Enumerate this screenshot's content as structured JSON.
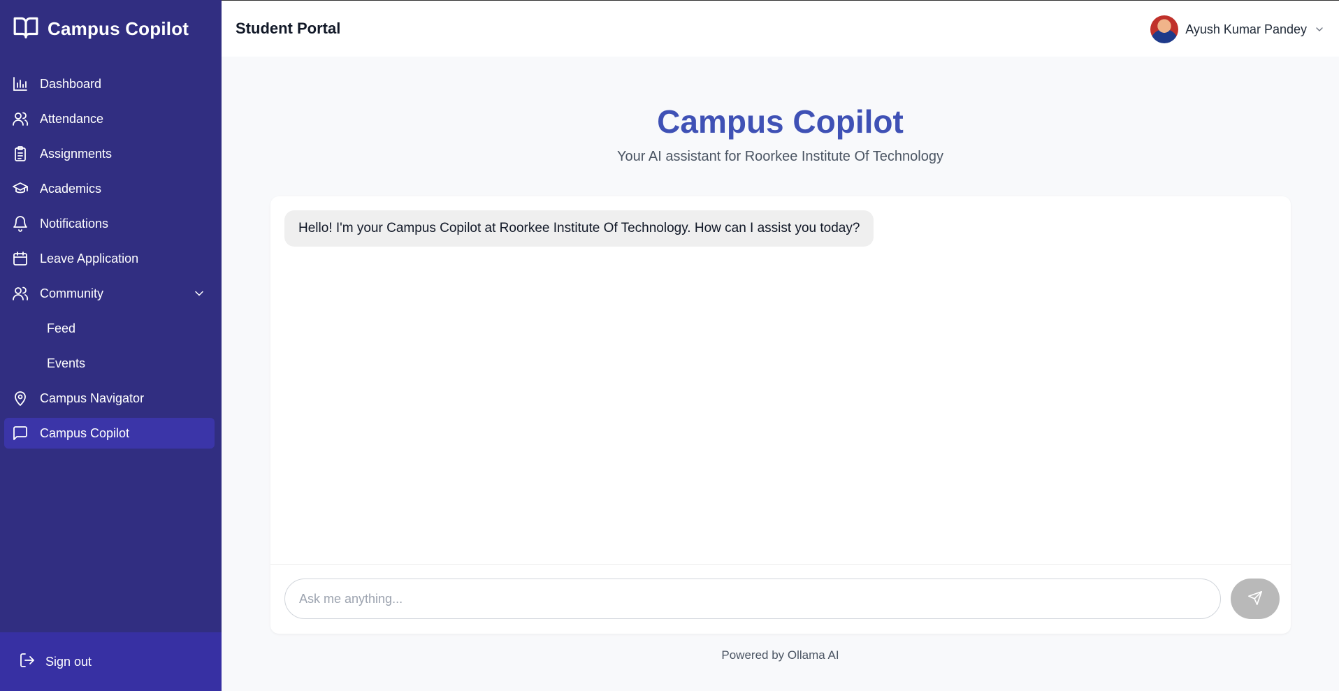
{
  "app": {
    "brand": "Campus Copilot"
  },
  "sidebar": {
    "items": [
      {
        "label": "Dashboard",
        "icon": "bar-chart-icon"
      },
      {
        "label": "Attendance",
        "icon": "users-icon"
      },
      {
        "label": "Assignments",
        "icon": "clipboard-icon"
      },
      {
        "label": "Academics",
        "icon": "graduation-cap-icon"
      },
      {
        "label": "Notifications",
        "icon": "bell-icon"
      },
      {
        "label": "Leave Application",
        "icon": "calendar-icon"
      },
      {
        "label": "Community",
        "icon": "users-icon",
        "expanded": true
      },
      {
        "label": "Campus Navigator",
        "icon": "map-pin-icon"
      },
      {
        "label": "Campus Copilot",
        "icon": "message-square-icon",
        "active": true
      }
    ],
    "community_sub": [
      {
        "label": "Feed"
      },
      {
        "label": "Events"
      }
    ],
    "signout_label": "Sign out"
  },
  "header": {
    "title": "Student Portal",
    "user_name": "Ayush Kumar Pandey"
  },
  "main": {
    "title": "Campus Copilot",
    "subtitle": "Your AI assistant for Roorkee Institute Of Technology",
    "messages": [
      {
        "role": "assistant",
        "text": "Hello! I'm your Campus Copilot at Roorkee Institute Of Technology. How can I assist you today?"
      }
    ],
    "input_placeholder": "Ask me anything...",
    "input_value": "",
    "footer": "Powered by Ollama AI"
  },
  "colors": {
    "sidebar_bg": "#312e81",
    "sidebar_active": "#3b35a8",
    "sidebar_footer": "#3730a3",
    "title_accent": "#3f51b5",
    "send_button": "#b9b9b9"
  }
}
